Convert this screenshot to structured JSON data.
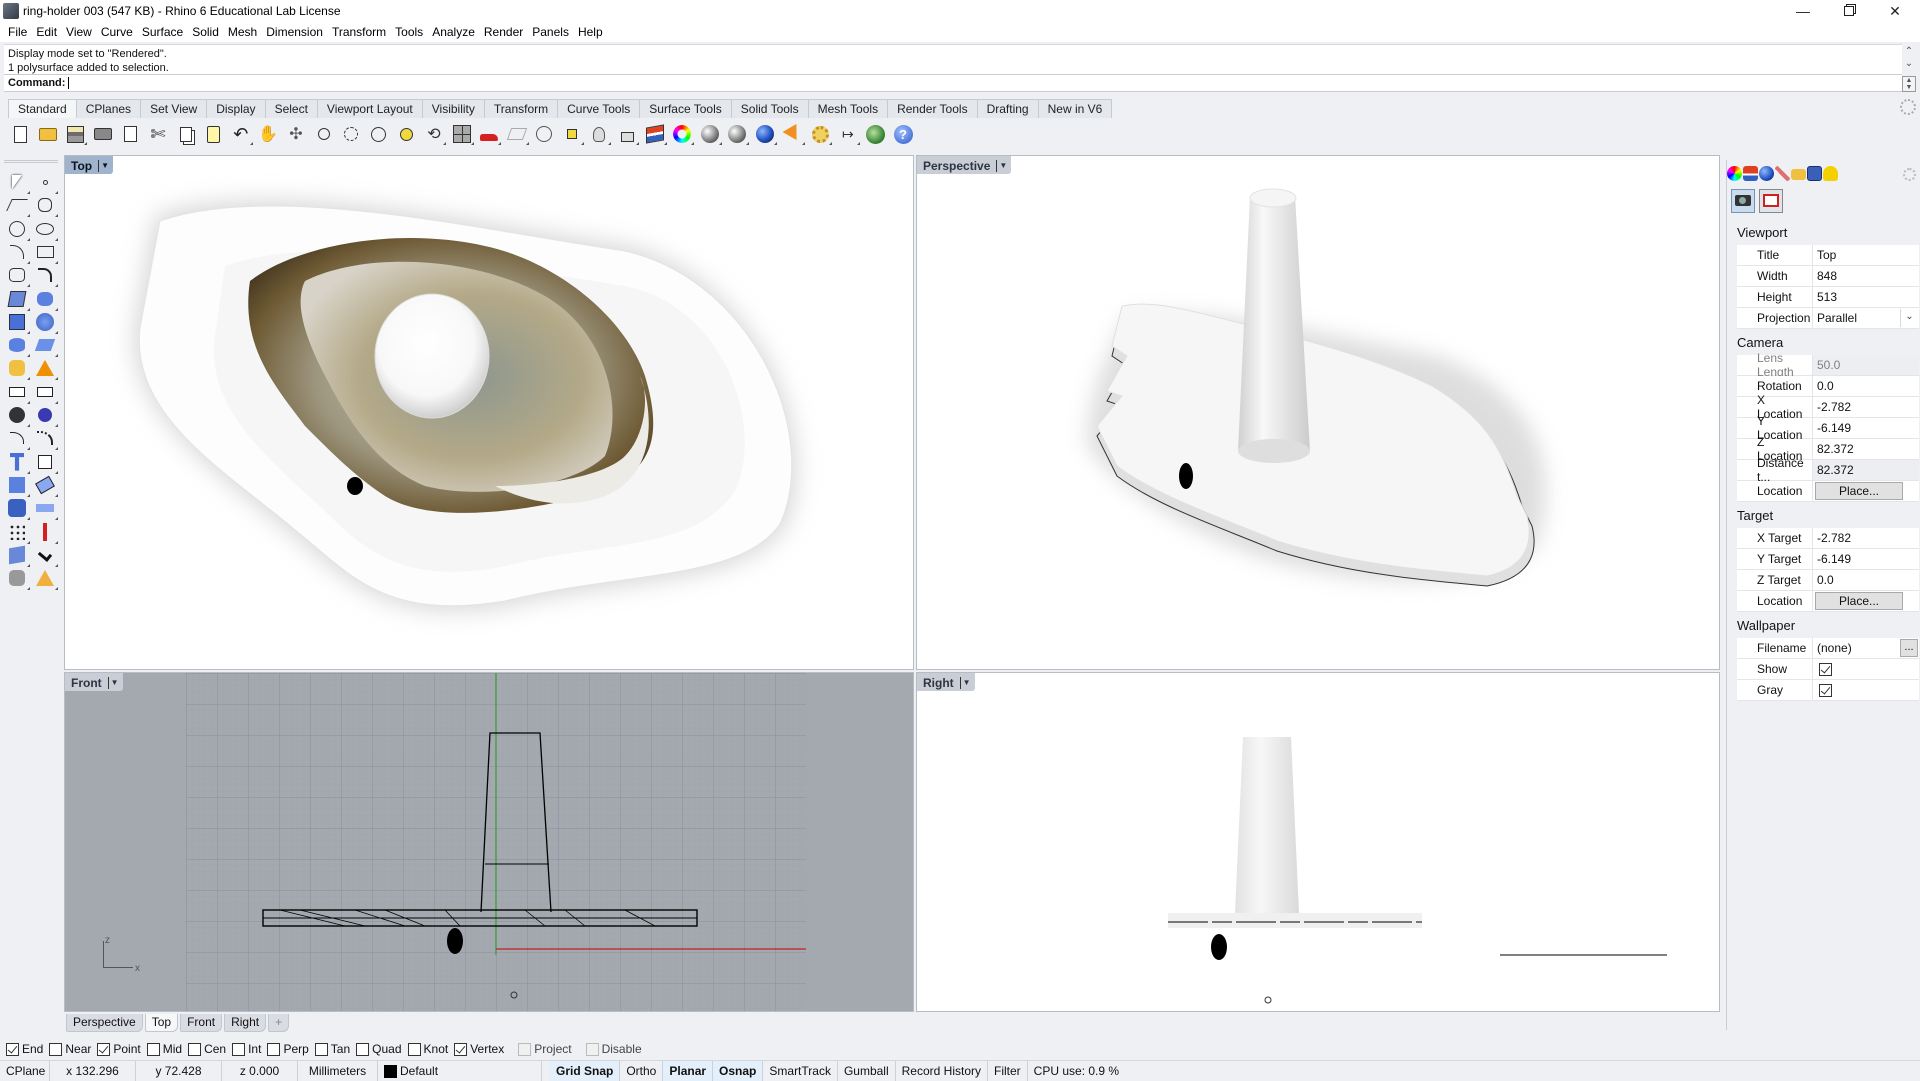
{
  "window": {
    "title": "ring-holder 003 (547 KB) - Rhino 6 Educational Lab License",
    "controls": [
      "minimize",
      "restore",
      "close"
    ]
  },
  "menu": [
    "File",
    "Edit",
    "View",
    "Curve",
    "Surface",
    "Solid",
    "Mesh",
    "Dimension",
    "Transform",
    "Tools",
    "Analyze",
    "Render",
    "Panels",
    "Help"
  ],
  "command": {
    "history": [
      "Display mode set to \"Rendered\".",
      "1 polysurface added to selection."
    ],
    "prompt": "Command:",
    "value": ""
  },
  "toolbar_tabs": {
    "active": "Standard",
    "items": [
      "Standard",
      "CPlanes",
      "Set View",
      "Display",
      "Select",
      "Viewport Layout",
      "Visibility",
      "Transform",
      "Curve Tools",
      "Surface Tools",
      "Solid Tools",
      "Mesh Tools",
      "Render Tools",
      "Drafting",
      "New in V6"
    ]
  },
  "toolbar_icons": [
    "new-icon",
    "open-icon",
    "save-icon",
    "print-icon",
    "import-icon",
    "cut-icon",
    "copy-icon",
    "paste-icon",
    "undo-icon",
    "pan-icon",
    "rotate-view-icon",
    "zoom-dynamic-icon",
    "zoom-window-icon",
    "zoom-extents-icon",
    "zoom-selected-icon",
    "undo-view-icon",
    "four-viewports-icon",
    "car-icon",
    "cplane-icon",
    "circle-point-icon",
    "select-points-icon",
    "light-bulb-icon",
    "lock-icon",
    "layer-icon",
    "color-wheel-icon",
    "render-sphere-icon",
    "render-sphere-grid-icon",
    "blue-sphere-icon",
    "spotlight-icon",
    "gear-settings-icon",
    "dimension-icon",
    "globe-icon",
    "help-icon"
  ],
  "left_tools": [
    "select-arrow-icon",
    "point-icon",
    "polyline-icon",
    "curve-cv-icon",
    "circle-icon",
    "ellipse-icon",
    "arc-icon",
    "rectangle-icon",
    "polygon-icon",
    "fillet-curve-icon",
    "surface-points-icon",
    "surface-edge-icon",
    "box-icon",
    "boolean-union-icon",
    "cylinder-icon",
    "extrude-surface-icon",
    "join-icon",
    "explode-icon",
    "trim-icon",
    "split-icon",
    "group-icon",
    "ungroup-icon",
    "offset-curve-icon",
    "fillet-edge-icon",
    "text-icon",
    "move-icon",
    "array-icon",
    "rotate-icon",
    "solid-edit-icon",
    "extrude-icon",
    "grid-array-icon",
    "align-icon",
    "mirror-icon",
    "check-icon",
    "mesh-icon",
    "render-icon"
  ],
  "viewports": {
    "top": {
      "label": "Top",
      "active": true
    },
    "perspective": {
      "label": "Perspective",
      "active": false
    },
    "front": {
      "label": "Front",
      "active": false,
      "axes": {
        "x": "x",
        "z": "z"
      }
    },
    "right": {
      "label": "Right",
      "active": false
    }
  },
  "viewport_tabs": {
    "active": "Top",
    "items": [
      "Perspective",
      "Top",
      "Front",
      "Right"
    ],
    "add": "+"
  },
  "osnaps": [
    {
      "label": "End",
      "checked": true
    },
    {
      "label": "Near",
      "checked": false
    },
    {
      "label": "Point",
      "checked": true
    },
    {
      "label": "Mid",
      "checked": false
    },
    {
      "label": "Cen",
      "checked": false
    },
    {
      "label": "Int",
      "checked": false
    },
    {
      "label": "Perp",
      "checked": false
    },
    {
      "label": "Tan",
      "checked": false
    },
    {
      "label": "Quad",
      "checked": false
    },
    {
      "label": "Knot",
      "checked": false
    },
    {
      "label": "Vertex",
      "checked": true
    },
    {
      "label": "Project",
      "checked": false,
      "disabled": true
    },
    {
      "label": "Disable",
      "checked": false,
      "disabled": true
    }
  ],
  "status": {
    "cplane": "CPlane",
    "x": "x 132.296",
    "y": "y 72.428",
    "z": "z 0.000",
    "units": "Millimeters",
    "layer": "Default",
    "layer_color": "#000000",
    "toggles": [
      {
        "label": "Grid Snap",
        "on": true
      },
      {
        "label": "Ortho",
        "on": false
      },
      {
        "label": "Planar",
        "on": true
      },
      {
        "label": "Osnap",
        "on": true
      },
      {
        "label": "SmartTrack",
        "on": false
      },
      {
        "label": "Gumball",
        "on": false
      },
      {
        "label": "Record History",
        "on": false
      },
      {
        "label": "Filter",
        "on": false
      }
    ],
    "cpu": "CPU use: 0.9 %"
  },
  "properties": {
    "tab_icons": [
      "color-wheel-icon",
      "layer-icon",
      "material-sphere-icon",
      "render-brush-icon",
      "folder-icon",
      "help-window-icon",
      "bell-icon"
    ],
    "mode_buttons": [
      "camera-icon",
      "viewport-frame-icon"
    ],
    "viewport": {
      "heading": "Viewport",
      "title_label": "Title",
      "title": "Top",
      "width_label": "Width",
      "width": "848",
      "height_label": "Height",
      "height": "513",
      "projection_label": "Projection",
      "projection": "Parallel"
    },
    "camera": {
      "heading": "Camera",
      "lens_label": "Lens Length",
      "lens": "50.0",
      "rotation_label": "Rotation",
      "rotation": "0.0",
      "xloc_label": "X Location",
      "xloc": "-2.782",
      "yloc_label": "Y Location",
      "yloc": "-6.149",
      "zloc_label": "Z Location",
      "zloc": "82.372",
      "dist_label": "Distance t...",
      "dist": "82.372",
      "location_label": "Location",
      "place": "Place..."
    },
    "target": {
      "heading": "Target",
      "x_label": "X Target",
      "x": "-2.782",
      "y_label": "Y Target",
      "y": "-6.149",
      "z_label": "Z Target",
      "z": "0.0",
      "location_label": "Location",
      "place": "Place..."
    },
    "wallpaper": {
      "heading": "Wallpaper",
      "filename_label": "Filename",
      "filename": "(none)",
      "browse": "...",
      "show_label": "Show",
      "show": true,
      "gray_label": "Gray",
      "gray": true
    }
  }
}
